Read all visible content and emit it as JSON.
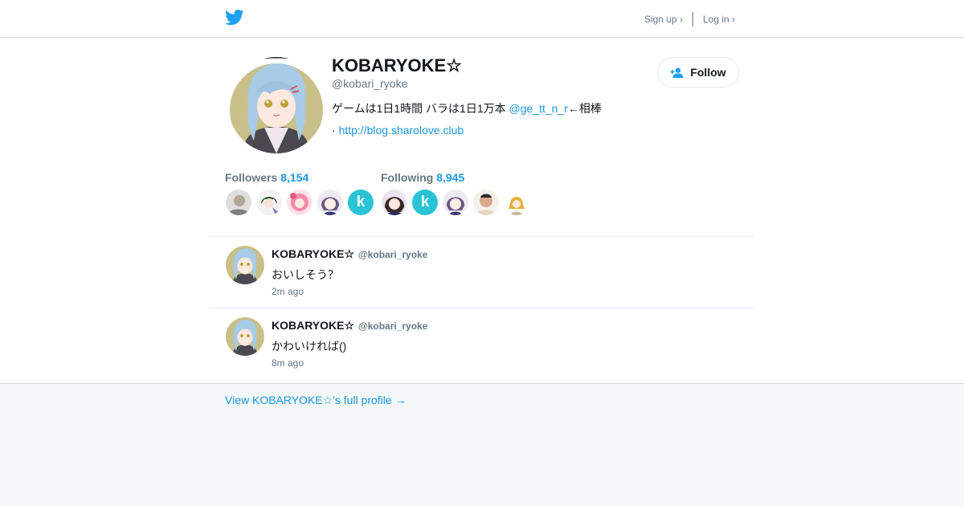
{
  "header": {
    "logo_icon": "twitter-bird-icon",
    "signup_label": "Sign up ›",
    "login_label": "Log in ›"
  },
  "profile": {
    "name": "KOBARYOKE☆",
    "handle": "@kobari_ryoke",
    "bio_text": "ゲームは1日1時間 バラは1日1万本 ",
    "bio_mention": "@ge_tt_n_r",
    "bio_suffix": "←相棒",
    "url_prefix": "· ",
    "url": "http://blog.sharolove.club",
    "follow_label": "Follow"
  },
  "stats": {
    "followers_label": "Followers",
    "followers_count": "8,154",
    "following_label": "Following",
    "following_count": "8,945",
    "k_letter": "k"
  },
  "tweets": [
    {
      "name": "KOBARYOKE☆",
      "handle": "@kobari_ryoke",
      "text": "おいしそう？",
      "time": "2m ago"
    },
    {
      "name": "KOBARYOKE☆",
      "handle": "@kobari_ryoke",
      "text": "かわいければ()",
      "time": "8m ago"
    }
  ],
  "footer": {
    "full_profile_label": "View KOBARYOKE☆'s full profile →"
  },
  "colors": {
    "accent": "#1b95e0",
    "twitter_blue": "#1da1f2",
    "k_avatar": "#2ac3d6"
  }
}
